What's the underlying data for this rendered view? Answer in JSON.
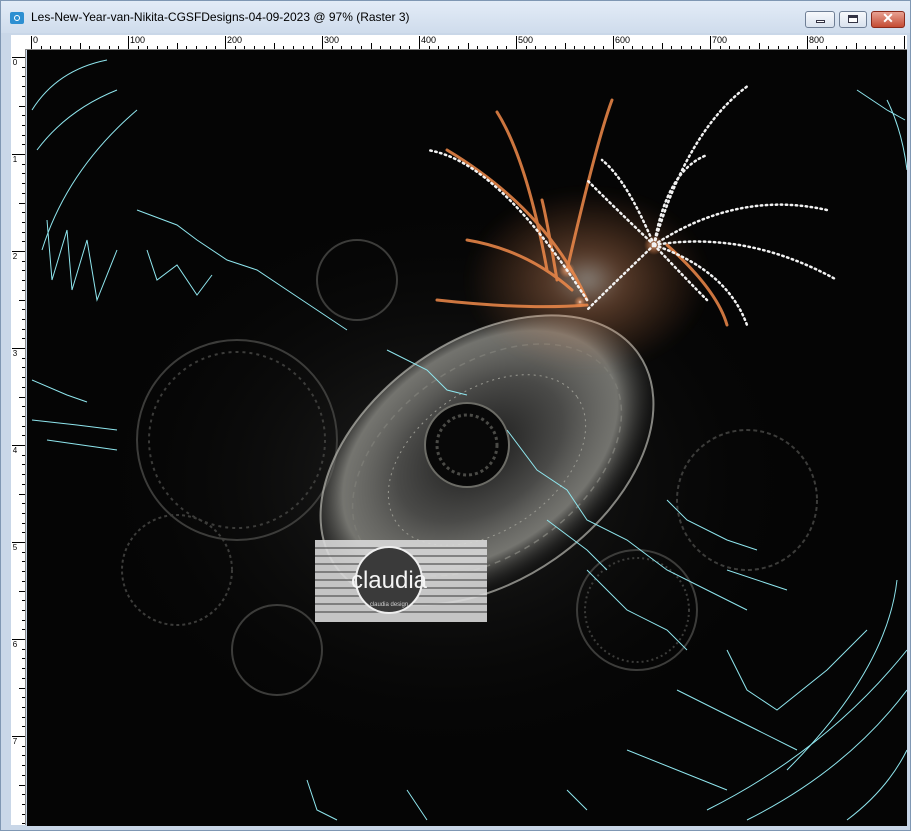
{
  "window": {
    "title": "Les-New-Year-van-Nikita-CGSFDesigns-04-09-2023 @  97% (Raster 3)",
    "close_glyph": "✕"
  },
  "ruler": {
    "h_labels": [
      "0",
      "100",
      "200",
      "300",
      "400",
      "500",
      "600",
      "700",
      "800"
    ],
    "v_labels": [
      "0",
      "1",
      "2",
      "3",
      "4",
      "5",
      "6",
      "7"
    ]
  },
  "watermark": {
    "text": "claudia",
    "subtext": "claudia design"
  },
  "colors": {
    "titlebar": "#dbe6f3",
    "canvas": "#050505",
    "outline": "#8fe6ee",
    "firework_orange": "#f08a4a",
    "firework_white": "#f2f2f2"
  }
}
